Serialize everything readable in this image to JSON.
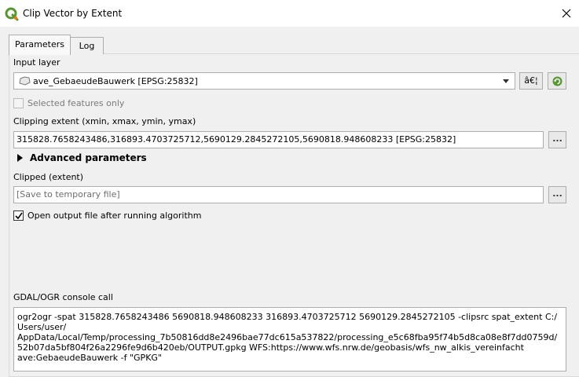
{
  "window": {
    "title": "Clip Vector by Extent",
    "icon": "qgis-logo-icon"
  },
  "tabs": [
    {
      "label": "Parameters",
      "active": true
    },
    {
      "label": "Log",
      "active": false
    }
  ],
  "input_layer": {
    "label": "Input layer",
    "value": "ave_GebaeudeBauwerk [EPSG:25832]",
    "edit_button": "â€¦",
    "selected_only_label": "Selected features only"
  },
  "clipping_extent": {
    "label": "Clipping extent (xmin, xmax, ymin, ymax)",
    "value": "315828.7658243486,316893.4703725712,5690129.2845272105,5690818.948608233 [EPSG:25832]",
    "browse_button": "..."
  },
  "advanced": {
    "label": "Advanced parameters"
  },
  "clipped": {
    "label": "Clipped (extent)",
    "placeholder": "[Save to temporary file]",
    "browse_button": "..."
  },
  "open_output": {
    "label": "Open output file after running algorithm",
    "checked": true
  },
  "console": {
    "label": "GDAL/OGR console call",
    "lines": [
      "ogr2ogr -spat 315828.7658243486 5690818.948608233 316893.4703725712 5690129.2845272105 -clipsrc spat_extent C:/Users/user/",
      "AppData/Local/Temp/processing_7b50816dd8e2496bae77dc615a537822/processing_e5c68fba95f74b5d8ca08e8f7dd0759d/",
      "52b07da5bf804f26a2296fe9d6b420eb/OUTPUT.gpkg WFS:https://www.wfs.nrw.de/geobasis/wfs_nw_alkis_vereinfacht",
      "ave:GebaeudeBauwerk -f \"GPKG\""
    ]
  },
  "colors": {
    "qgis_green": "#589632",
    "qgis_yellow": "#ee7913"
  }
}
